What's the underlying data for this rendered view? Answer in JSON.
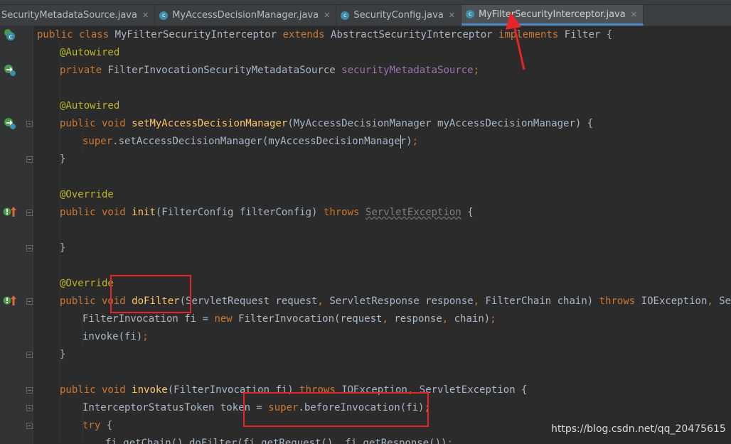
{
  "tabs": [
    {
      "label": "SecurityMetadataSource.java",
      "close": "✕",
      "active": false
    },
    {
      "label": "MyAccessDecisionManager.java",
      "close": "✕",
      "active": false
    },
    {
      "label": "SecurityConfig.java",
      "close": "✕",
      "active": false
    },
    {
      "label": "MyFilterSecurityInterceptor.java",
      "close": "✕",
      "active": true
    }
  ],
  "tab_icon_letter": "c",
  "colors": {
    "keyword": "#cc7832",
    "annotation": "#bbb529",
    "field": "#9876aa",
    "method_decl": "#ffc66d",
    "text": "#a9b7c6",
    "highlight_box": "#e8232a",
    "active_tab_underline": "#4a88c7"
  },
  "gutter_icons": [
    "class-icon",
    "implementing-icon",
    "implementing-icon",
    "override-icon",
    "override-icon"
  ],
  "code": {
    "l1": [
      "public class ",
      "MyFilterSecurityInterceptor ",
      "extends ",
      "AbstractSecurityInterceptor ",
      "implements ",
      "Filter {"
    ],
    "l2": "@Autowired",
    "l3": [
      "private ",
      "FilterInvocationSecurityMetadataSource ",
      "securityMetadataSource",
      ";"
    ],
    "l5": "@Autowired",
    "l6": [
      "public void ",
      "setMyAccessDecisionManager",
      "(MyAccessDecisionManager myAccessDecisionManager) {"
    ],
    "l7": [
      "super",
      ".setAccessDecisionManager(myAccessDecisionManager)",
      ";"
    ],
    "l8": "}",
    "l10": "@Override",
    "l11": [
      "public void ",
      "init",
      "(FilterConfig filterConfig) ",
      "throws ",
      "ServletException",
      " {"
    ],
    "l13": "}",
    "l15": "@Override",
    "l16": [
      "public void ",
      "doFilter",
      "(ServletRequest request",
      ", ",
      "ServletResponse response",
      ", ",
      "FilterChain chain) ",
      "throws ",
      "IOException",
      ", ",
      "ServletE"
    ],
    "l17": [
      "FilterInvocation fi = ",
      "new ",
      "FilterInvocation(request",
      ", ",
      "response",
      ", ",
      "chain)",
      ";"
    ],
    "l18": [
      "invoke(fi)",
      ";"
    ],
    "l19": "}",
    "l21": [
      "public void ",
      "invoke",
      "(FilterInvocation fi) ",
      "throws ",
      "IOException",
      ", ",
      "ServletException {"
    ],
    "l22": [
      "InterceptorStatusToken token = ",
      "super",
      ".beforeInvocation(fi)",
      ";"
    ],
    "l23": [
      "try ",
      "{"
    ],
    "l24": [
      "fi.getChain().doFilter(fi.getRequest()",
      ", ",
      "fi.getResponse())",
      ";"
    ]
  },
  "watermark": "https://blog.csdn.net/qq_20475615"
}
